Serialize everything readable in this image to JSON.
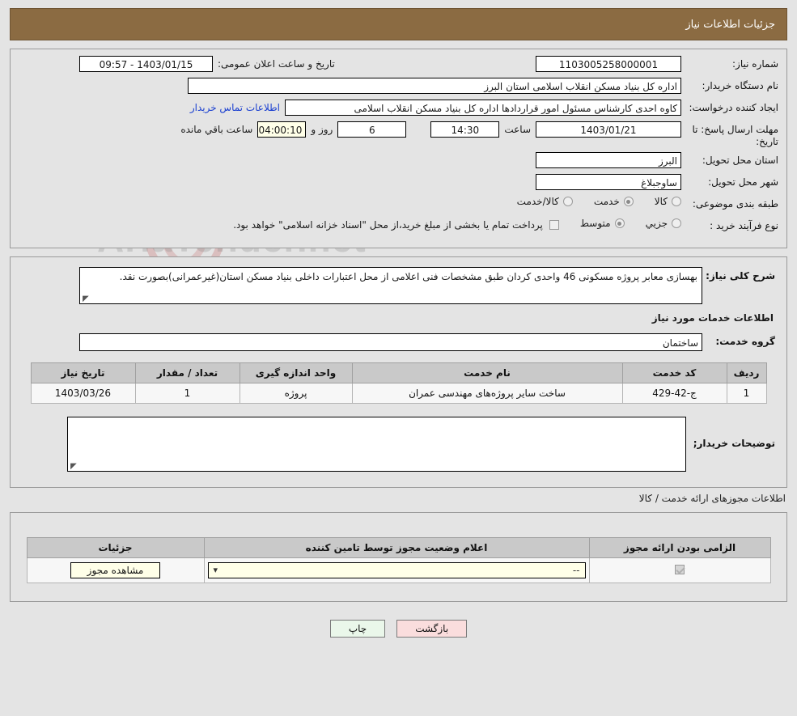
{
  "header": {
    "title": "جزئیات اطلاعات نیاز"
  },
  "need": {
    "number_label": "شماره نیاز:",
    "number_value": "1103005258000001",
    "announce_label": "تاریخ و ساعت اعلان عمومی:",
    "announce_value": "1403/01/15 - 09:57",
    "buyer_org_label": "نام دستگاه خریدار:",
    "buyer_org_value": "اداره کل بنیاد مسکن انقلاب اسلامی استان البرز",
    "creator_label": "ایجاد کننده درخواست:",
    "creator_value": "کاوه احدی کارشناس مسئول امور قراردادها اداره کل بنیاد مسکن انقلاب اسلامی",
    "contact_link": "اطلاعات تماس خریدار",
    "deadline_label": "مهلت ارسال پاسخ: تا تاریخ:",
    "deadline_date": "1403/01/21",
    "deadline_hour_label": "ساعت",
    "deadline_hour": "14:30",
    "remaining_days": "6",
    "days_and_label": "روز و",
    "remaining_time": "04:00:10",
    "remaining_suffix": "ساعت باقي مانده",
    "province_label": "استان محل تحویل:",
    "province_value": "البرز",
    "city_label": "شهر محل تحویل:",
    "city_value": "ساوجبلاغ",
    "category_label": "طبقه بندی موضوعی:",
    "category_options": [
      {
        "label": "کالا",
        "selected": false
      },
      {
        "label": "خدمت",
        "selected": true
      },
      {
        "label": "کالا/خدمت",
        "selected": false
      }
    ],
    "process_label": "نوع فرآیند خرید :",
    "process_options": [
      {
        "label": "جزیي",
        "selected": false
      },
      {
        "label": "متوسط",
        "selected": true
      }
    ],
    "treasury_checkbox_checked": false,
    "treasury_note": "پرداخت تمام یا بخشی از مبلغ خرید،از محل \"اسناد خزانه اسلامی\" خواهد بود."
  },
  "description": {
    "label": "شرح کلی نیاز:",
    "value": "بهسازی معابر پروژه مسکونی 46 واحدی کردان طبق مشخصات فنی اعلامی از محل اعتبارات داخلی بنیاد مسکن استان(غیرعمرانی)بصورت نقد."
  },
  "services": {
    "section_title": "اطلاعات خدمات مورد نیاز",
    "group_label": "گروه خدمت:",
    "group_value": "ساختمان",
    "columns": [
      "ردیف",
      "کد خدمت",
      "نام خدمت",
      "واحد اندازه گیری",
      "تعداد / مقدار",
      "تاریخ نیاز"
    ],
    "rows": [
      {
        "row": "1",
        "code": "ج-42-429",
        "name": "ساخت سایر پروژه‌های مهندسی عمران",
        "unit": "پروژه",
        "quantity": "1",
        "date": "1403/03/26"
      }
    ]
  },
  "buyer_notes": {
    "label": "توضیحات خریدار;",
    "value": ""
  },
  "permits": {
    "section_title": "اطلاعات مجوزهای ارائه خدمت / کالا",
    "columns": [
      "الزامی بودن ارائه مجوز",
      "اعلام وضعیت مجوز توسط تامین کننده",
      "جزئیات"
    ],
    "rows": [
      {
        "required_checked": true,
        "status_value": "--",
        "details_button": "مشاهده مجوز"
      }
    ]
  },
  "footer": {
    "print_label": "چاپ",
    "back_label": "بازگشت"
  },
  "watermark": {
    "text": "AriaTender.net"
  },
  "colors": {
    "header_bar": "#8b6b42",
    "link": "#1a3fd0",
    "page_bg": "#e4e4e4",
    "table_header": "#c9c9c9",
    "cream_field": "#ffffe8",
    "print_button": "#eaf7ea",
    "back_button": "#fadddd"
  }
}
